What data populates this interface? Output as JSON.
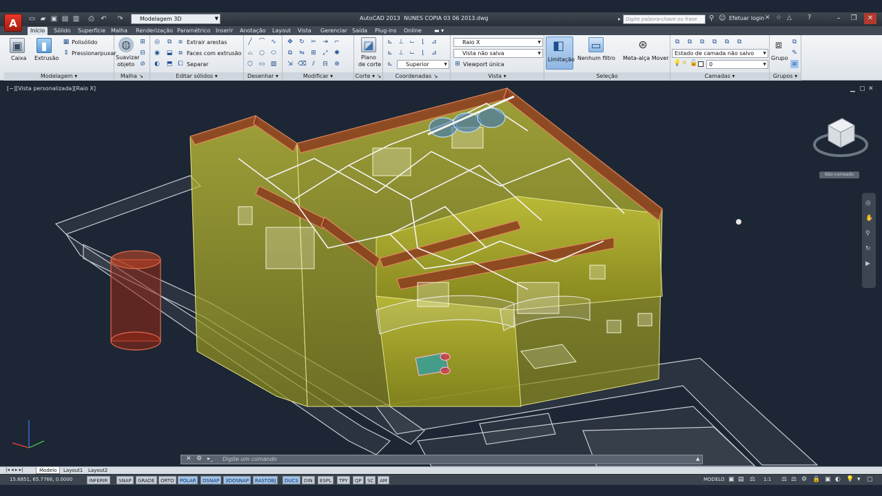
{
  "app": {
    "name": "AutoCAD 2013",
    "file": "NUNES COPIA 03 06 2013.dwg",
    "menu_letter": "A"
  },
  "workspace": "Modelagem 3D",
  "search_placeholder": "Digite palavra-chave ou frase",
  "login": "Efetuar login",
  "tabs": [
    "Início",
    "Sólido",
    "Superfície",
    "Malha",
    "Renderização",
    "Paramétrico",
    "Inserir",
    "Anotação",
    "Layout",
    "Vista",
    "Gerenciar",
    "Saída",
    "Plug-ins",
    "Online"
  ],
  "ribbon": {
    "modelagem": {
      "title": "Modelagem",
      "caixa": "Caixa",
      "extrusao": "Extrusão",
      "polisolido": "Polisólido",
      "pressionar": "Pressionarpuxar"
    },
    "malha": {
      "title": "Malha",
      "suavizar_1": "Suavizar",
      "suavizar_2": "objeto"
    },
    "editar": {
      "title": "Editar sólidos",
      "extrair": "Extrair arestas",
      "faces": "Faces com extrusão",
      "separar": "Separar"
    },
    "desenhar": {
      "title": "Desenhar"
    },
    "modificar": {
      "title": "Modificar"
    },
    "corte": {
      "title": "Corte",
      "plano_1": "Plano",
      "plano_2": "de corte"
    },
    "coordenadas": {
      "title": "Coordenadas",
      "superior": "Superior"
    },
    "vista": {
      "title": "Vista",
      "raio": "Raio X",
      "vista_salva": "Vista não salva",
      "viewport": "Viewport única"
    },
    "selecao": {
      "title": "Seleção",
      "limitacao": "Limitação",
      "filtro_1": "Nenhum filtro",
      "meta": "Meta-alça Mover"
    },
    "camadas": {
      "title": "Camadas",
      "estado": "Estado de camada não salvo",
      "layer": "0"
    },
    "grupos": {
      "title": "Grupos",
      "grupo": "Grupo"
    }
  },
  "viewport": {
    "label": "[−][Vista personalizada][Raio X]",
    "viewcube_status": "Não nomeado"
  },
  "command_placeholder": "Digite um comando",
  "layout_tabs": [
    "Modelo",
    "Layout1",
    "Layout2"
  ],
  "status": {
    "coords": "15.6851, 65.7766, 0.0000",
    "toggles": [
      {
        "label": "INFERIR",
        "on": false
      },
      {
        "label": "SNAP",
        "on": false
      },
      {
        "label": "GRADE",
        "on": false
      },
      {
        "label": "ORTO",
        "on": false
      },
      {
        "label": "POLAR",
        "on": true
      },
      {
        "label": "OSNAP",
        "on": true
      },
      {
        "label": "3DOSNAP",
        "on": true
      },
      {
        "label": "RASTOBJ",
        "on": true
      },
      {
        "label": "DUCS",
        "on": true
      },
      {
        "label": "DIN",
        "on": false
      },
      {
        "label": "ESPL",
        "on": false
      },
      {
        "label": "TPY",
        "on": false
      },
      {
        "label": "QP",
        "on": false
      },
      {
        "label": "SC",
        "on": false
      },
      {
        "label": "AM",
        "on": false
      }
    ],
    "model": "MODELO",
    "scale": "1:1"
  },
  "colors": {
    "viewport_bg": "#1d2634",
    "building": "#c9c83a",
    "trim": "#8a3a1a",
    "accent": "#9fc4ec"
  }
}
